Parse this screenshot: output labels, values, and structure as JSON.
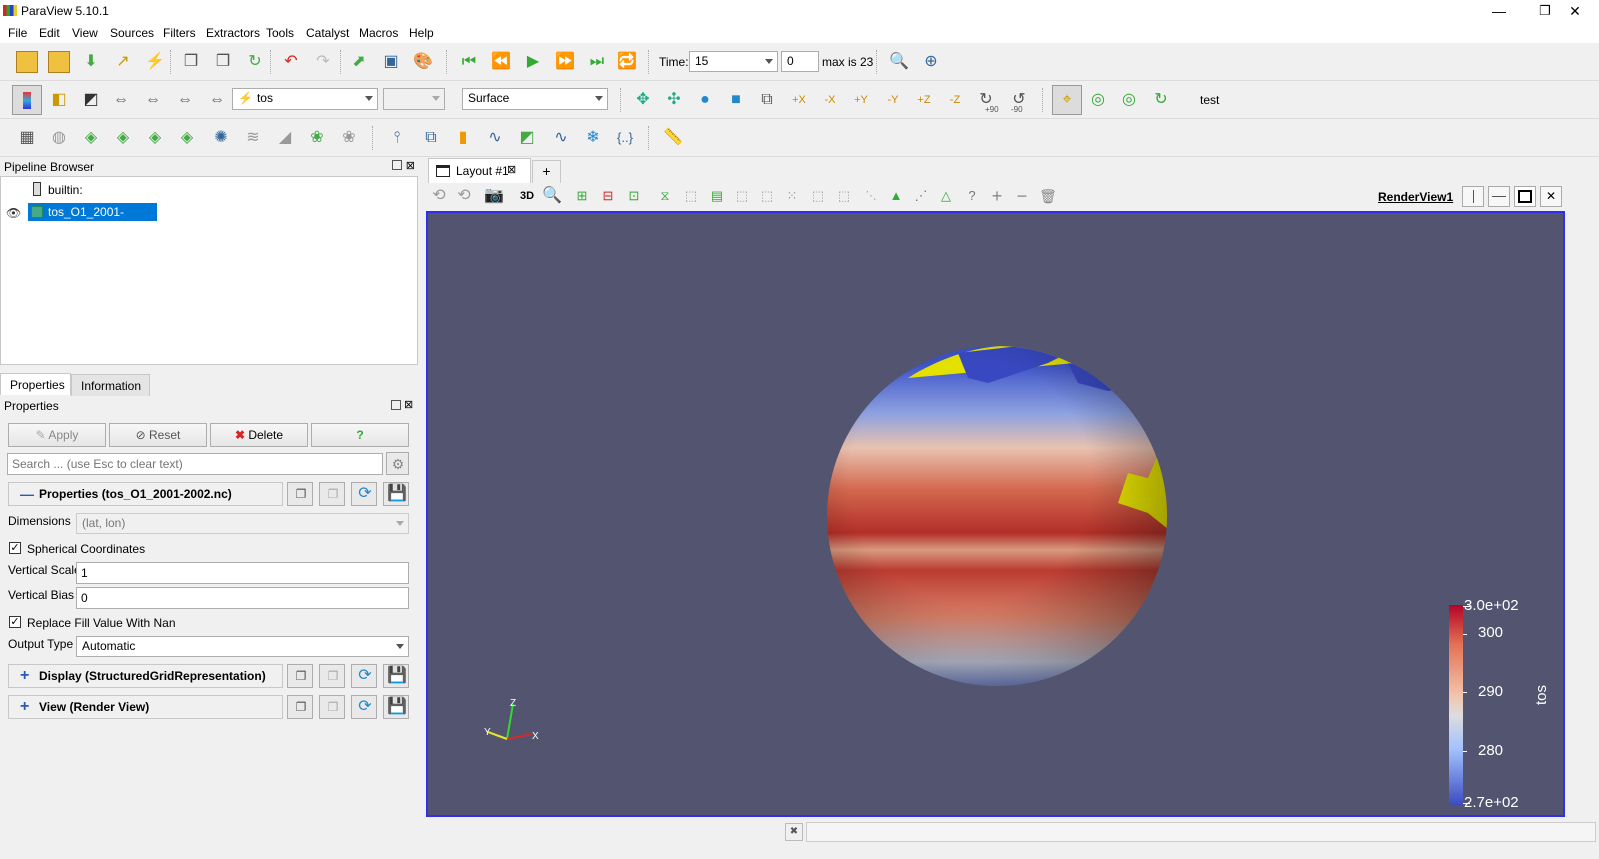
{
  "window": {
    "title": "ParaView 5.10.1",
    "min": "—",
    "restore": "❐",
    "close": "✕"
  },
  "menu": [
    "File",
    "Edit",
    "View",
    "Sources",
    "Filters",
    "Extractors",
    "Tools",
    "Catalyst",
    "Macros",
    "Help"
  ],
  "toolbar1": {
    "time_label": "Time:",
    "time_value": "15",
    "timestep": "0",
    "max_label": "max is 23"
  },
  "toolbar2": {
    "array": "tos",
    "component": "",
    "representation": "Surface",
    "rotate_pos90": "+90",
    "rotate_neg90": "-90",
    "test_label": "test"
  },
  "pipeline": {
    "header": "Pipeline Browser",
    "root": "builtin:",
    "source": "tos_O1_2001-2002.nc"
  },
  "tabs": {
    "properties": "Properties",
    "information": "Information"
  },
  "properties": {
    "header": "Properties",
    "apply": "Apply",
    "reset": "Reset",
    "delete": "Delete",
    "help": "?",
    "search_placeholder": "Search ... (use Esc to clear text)",
    "section_props": "Properties (tos_O1_2001-2002.nc)",
    "dimensions_label": "Dimensions",
    "dimensions_value": "(lat, lon)",
    "spherical_label": "Spherical Coordinates",
    "spherical_checked": true,
    "vscale_label": "Vertical Scale",
    "vscale_value": "1",
    "vbias_label": "Vertical Bias",
    "vbias_value": "0",
    "replace_label": "Replace Fill Value With Nan",
    "replace_checked": true,
    "output_label": "Output Type",
    "output_value": "Automatic",
    "section_display": "Display (StructuredGridRepresentation)",
    "section_view": "View (Render View)"
  },
  "layout": {
    "tab_label": "Layout #1",
    "add_tab": "+",
    "view_name": "RenderView1",
    "mode_3d": "3D"
  },
  "colorbar": {
    "title": "tos",
    "max": "3.0e+02",
    "min": "2.7e+02",
    "ticks": [
      "300",
      "290",
      "280"
    ]
  },
  "axes": {
    "x": "X",
    "y": "Y",
    "z": "Z"
  }
}
